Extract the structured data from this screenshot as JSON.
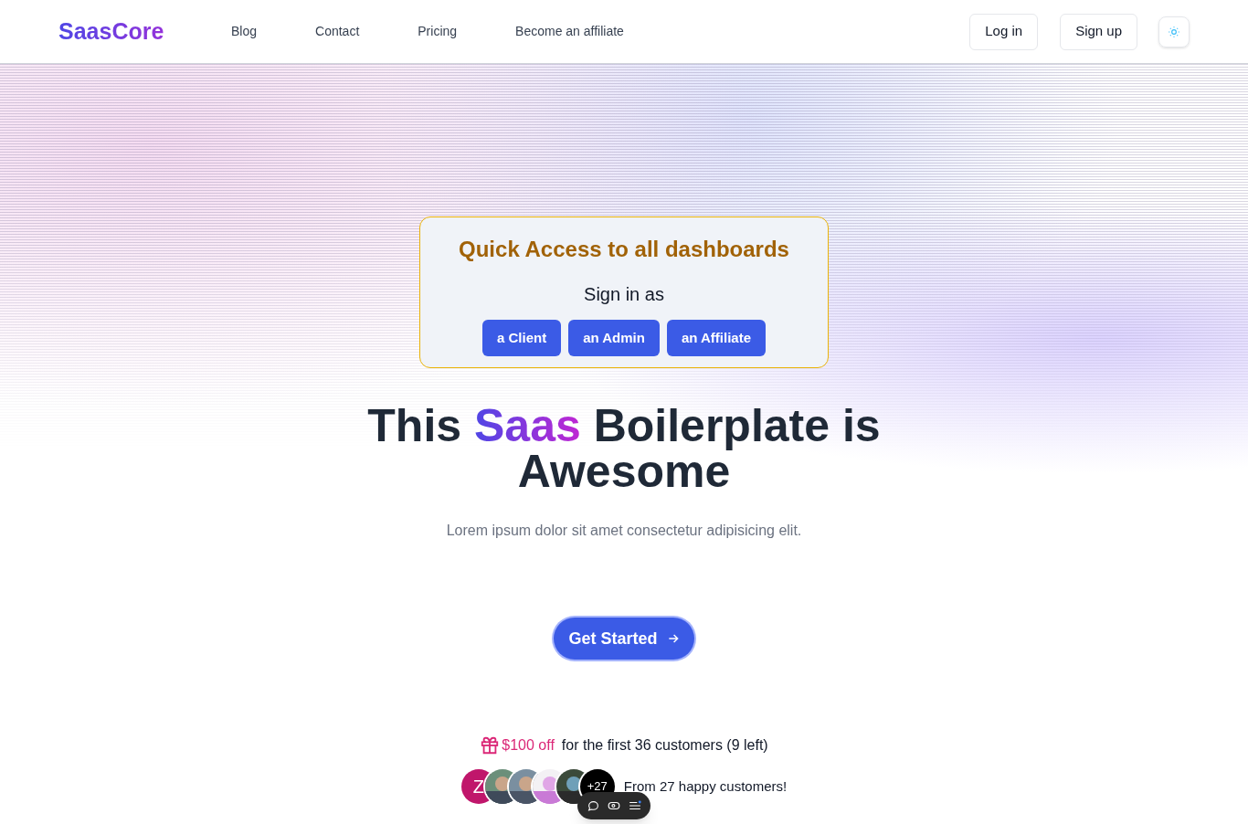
{
  "brand": "SaasCore",
  "nav": [
    {
      "label": "Blog"
    },
    {
      "label": "Contact"
    },
    {
      "label": "Pricing"
    },
    {
      "label": "Become an affiliate"
    }
  ],
  "auth_buttons": [
    {
      "label": "Log in"
    },
    {
      "label": "Sign up"
    }
  ],
  "quick_access": {
    "title": "Quick Access to all dashboards",
    "subtitle": "Sign in as",
    "buttons": [
      {
        "label": "a Client"
      },
      {
        "label": "an Admin"
      },
      {
        "label": "an Affiliate"
      }
    ]
  },
  "hero": {
    "title_before": "This ",
    "title_highlight": "Saas",
    "title_after": " Boilerplate is Awesome",
    "subtitle": "Lorem ipsum dolor sit amet consectetur adipisicing elit.",
    "cta": "Get Started"
  },
  "offer": {
    "discount": "$100 off",
    "text": "for the first 36 customers (9 left)"
  },
  "customers": {
    "avatars": [
      {
        "kind": "letter",
        "letter": "Z",
        "color": "#c0166b"
      },
      {
        "kind": "picture"
      },
      {
        "kind": "picture"
      },
      {
        "kind": "picture"
      },
      {
        "kind": "picture"
      },
      {
        "kind": "count",
        "text": "+27"
      }
    ],
    "text": "From 27 happy customers!"
  }
}
